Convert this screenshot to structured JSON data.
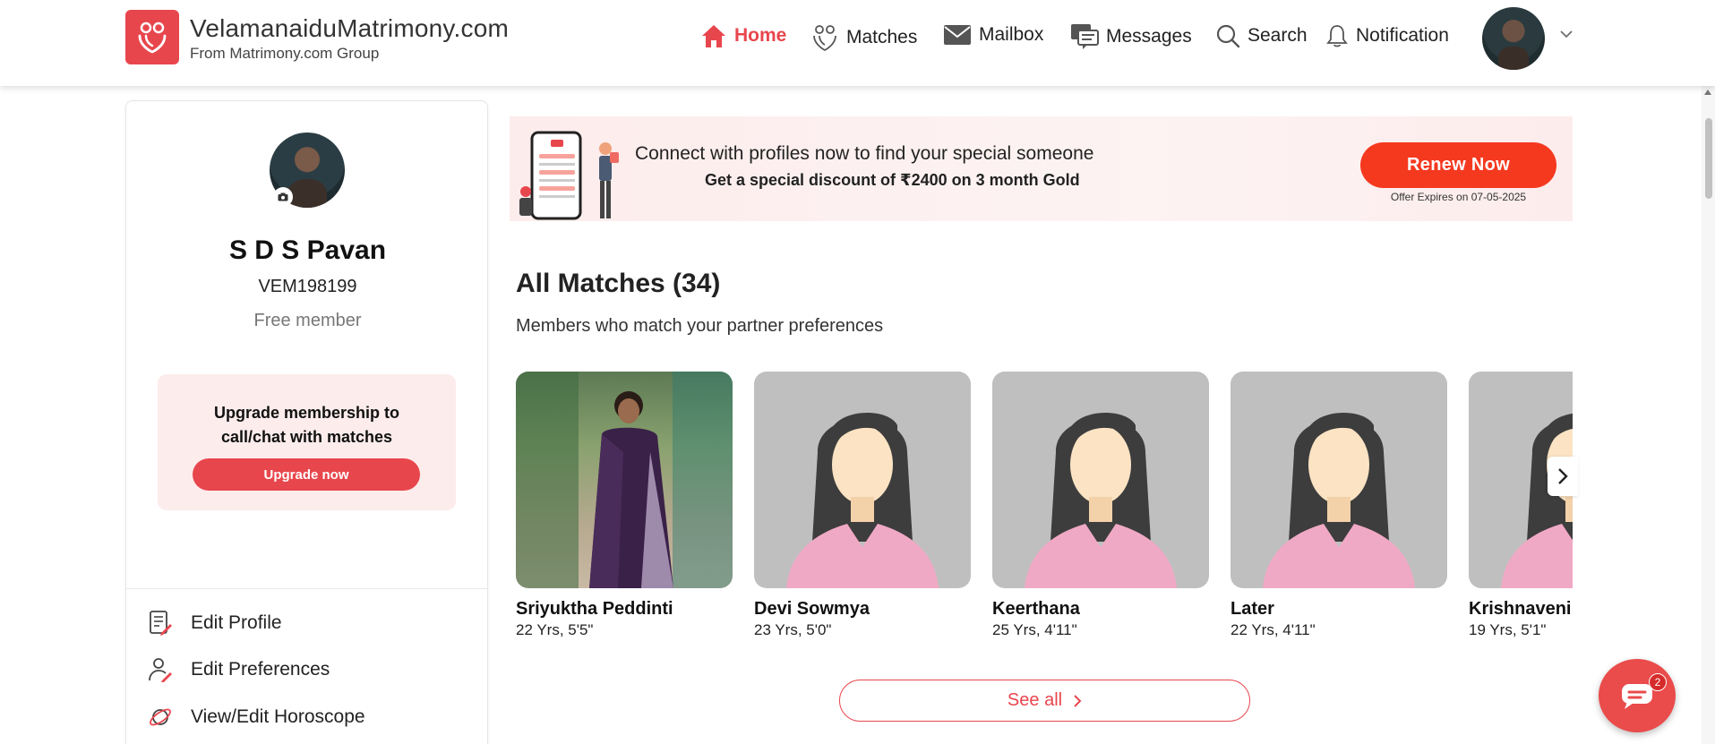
{
  "header": {
    "brand_name": "VelamanaiduMatrimony.com",
    "brand_sub": "From Matrimony.com Group",
    "nav": [
      {
        "label": "Home",
        "icon": "home-icon",
        "active": true
      },
      {
        "label": "Matches",
        "icon": "matches-icon",
        "active": false
      },
      {
        "label": "Mailbox",
        "icon": "mailbox-icon",
        "active": false
      },
      {
        "label": "Messages",
        "icon": "messages-icon",
        "active": false
      },
      {
        "label": "Search",
        "icon": "search-icon",
        "active": false
      },
      {
        "label": "Notification",
        "icon": "bell-icon",
        "active": false
      }
    ],
    "accent_color": "#e8464d"
  },
  "profile": {
    "name": "S D S Pavan",
    "id": "VEM198199",
    "tier": "Free member",
    "upgrade_text": "Upgrade membership to call/chat with matches",
    "upgrade_button": "Upgrade now"
  },
  "side_menu": [
    {
      "label": "Edit Profile",
      "icon": "edit-profile-icon"
    },
    {
      "label": "Edit Preferences",
      "icon": "edit-preferences-icon"
    },
    {
      "label": "View/Edit Horoscope",
      "icon": "horoscope-icon"
    }
  ],
  "banner": {
    "line1": "Connect with profiles now to find your special someone",
    "line2": "Get a special discount of ₹2400 on 3 month Gold",
    "renew_button": "Renew Now",
    "offer_expiry": "Offer Expires on 07-05-2025",
    "button_color": "#f5391f"
  },
  "matches": {
    "title": "All Matches (34)",
    "subtitle": "Members who match your partner preferences",
    "cards": [
      {
        "name": "Sriyuktha Peddinti",
        "meta": "22 Yrs, 5'5\"",
        "has_photo": true
      },
      {
        "name": "Devi Sowmya",
        "meta": "23 Yrs, 5'0\"",
        "has_photo": false
      },
      {
        "name": "Keerthana",
        "meta": "25 Yrs, 4'11\"",
        "has_photo": false
      },
      {
        "name": "Later",
        "meta": "22 Yrs, 4'11\"",
        "has_photo": false
      },
      {
        "name": "Krishnaveni",
        "meta": "19 Yrs, 5'1\"",
        "has_photo": false
      }
    ],
    "see_all": "See all"
  },
  "chat": {
    "badge_count": "2"
  }
}
